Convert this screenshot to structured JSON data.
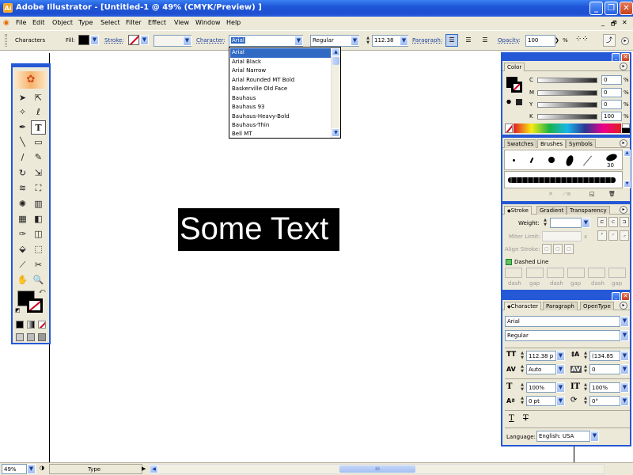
{
  "window": {
    "title": "Adobe Illustrator - [Untitled-1 @ 49% (CMYK/Preview) ]",
    "app_icon_glyph": "Ai",
    "minimize_glyph": "_",
    "maximize_glyph": "❐",
    "close_glyph": "✕"
  },
  "menubar": {
    "items": [
      "File",
      "Edit",
      "Object",
      "Type",
      "Select",
      "Filter",
      "Effect",
      "View",
      "Window",
      "Help"
    ],
    "doc_controls": [
      "_",
      "🗗",
      "✕"
    ]
  },
  "control_bar": {
    "mode_label": "Characters",
    "fill_label": "Fill:",
    "stroke_label": "Stroke:",
    "character_label": "Character:",
    "font_value": "Arial",
    "style_value": "Regular",
    "size_value": "112.38",
    "paragraph_label": "Paragraph:",
    "opacity_label": "Opacity:",
    "opacity_value": "100",
    "percent": "%",
    "colors": {
      "fill": "#000000",
      "stroke_none": "#d0021b"
    }
  },
  "font_dropdown": {
    "items": [
      "Arial",
      "Arial Black",
      "Arial Narrow",
      "Arial Rounded MT Bold",
      "Baskerville Old Face",
      "Bauhaus",
      "Bauhaus 93",
      "Bauhaus-Heavy-Bold",
      "Bauhaus-Thin",
      "Bell MT"
    ],
    "selected": "Arial",
    "scroll_up": "▲",
    "scroll_down": "▼"
  },
  "canvas": {
    "text_object": "Some Text"
  },
  "color_panel": {
    "tab": "Color",
    "channels": [
      {
        "label": "C",
        "value": "0"
      },
      {
        "label": "M",
        "value": "0"
      },
      {
        "label": "Y",
        "value": "0"
      },
      {
        "label": "K",
        "value": "100"
      }
    ],
    "percent": "%"
  },
  "brushes_panel": {
    "tabs": [
      "Swatches",
      "Brushes",
      "Symbols"
    ],
    "active_tab": "Brushes",
    "brush_size_label": "30"
  },
  "stroke_panel": {
    "tabs": [
      "Stroke",
      "Gradient",
      "Transparency"
    ],
    "active_tab": "Stroke",
    "weight_label": "Weight:",
    "miter_label": "Miter Limit:",
    "miter_x": "x",
    "align_label": "Align Stroke:",
    "dashed_label": "Dashed Line",
    "dash_labels": [
      "dash",
      "gap",
      "dash",
      "gap",
      "dash",
      "gap"
    ]
  },
  "character_panel": {
    "tabs": [
      "Character",
      "Paragraph",
      "OpenType"
    ],
    "active_tab": "Character",
    "font": "Arial",
    "style": "Regular",
    "size": "112.38 p",
    "leading": "(134.85",
    "kerning": "Auto",
    "tracking": "0",
    "vscale": "100%",
    "hscale": "100%",
    "baseline": "0 pt",
    "rotation": "0°",
    "language_label": "Language:",
    "language_value": "English: USA"
  },
  "statusbar": {
    "zoom": "49%",
    "tool": "Type"
  }
}
